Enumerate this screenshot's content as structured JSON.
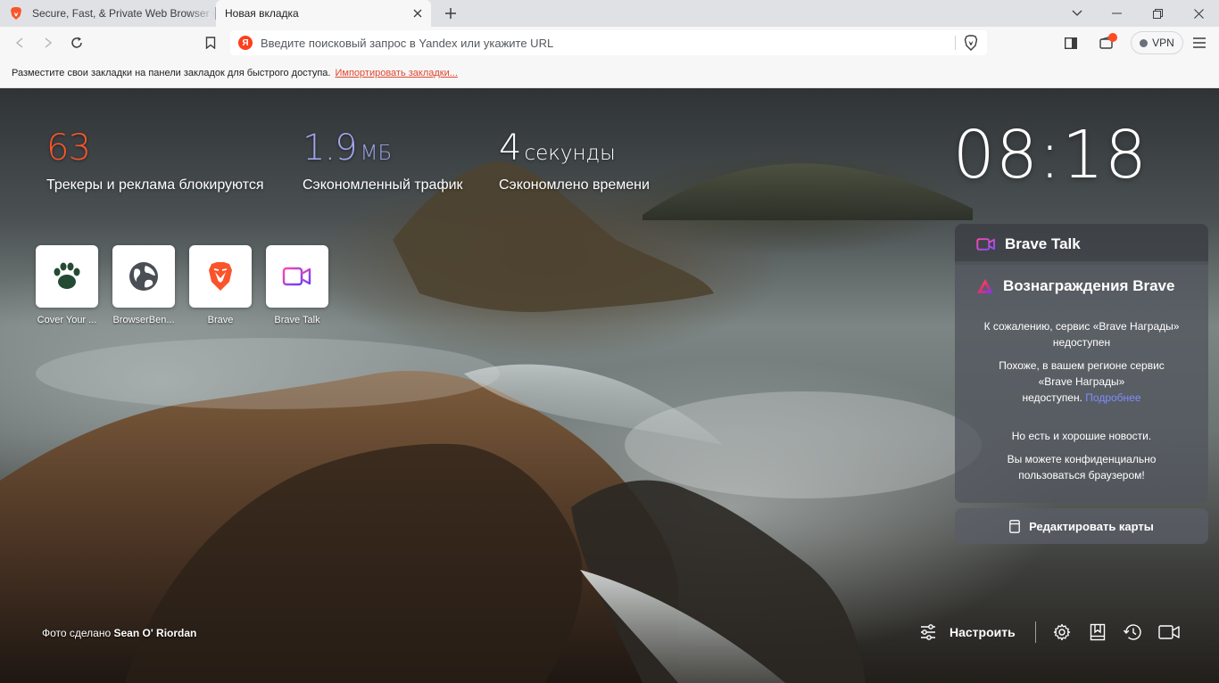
{
  "tabs": [
    {
      "title": "Secure, Fast, & Private Web Browser w",
      "icon": "brave-lion-icon",
      "active": false
    },
    {
      "title": "Новая вкладка",
      "active": true
    }
  ],
  "toolbar": {
    "search_engine_icon": "Я",
    "url_placeholder": "Введите поисковый запрос в Yandex или укажите URL",
    "vpn_label": "VPN"
  },
  "bookmarks_bar": {
    "message": "Разместите свои закладки на панели закладок для быстрого доступа.",
    "import_link": "Импортировать закладки..."
  },
  "stats": {
    "trackers": {
      "value": "63",
      "label": "Трекеры и реклама блокируются",
      "color": "#fb542b"
    },
    "bandwidth": {
      "value": "1.9",
      "unit": "МБ",
      "label": "Сэкономленный трафик",
      "color": "#a0a5eb"
    },
    "time": {
      "value": "4",
      "unit": "секунды",
      "label": "Сэкономлено времени",
      "color": "#ffffff"
    }
  },
  "clock": "08:18",
  "top_sites": [
    {
      "label": "Cover Your ...",
      "icon": "bear-paw-icon"
    },
    {
      "label": "BrowserBen...",
      "icon": "globe-icon"
    },
    {
      "label": "Brave",
      "icon": "brave-lion-icon"
    },
    {
      "label": "Brave Talk",
      "icon": "video-camera-icon"
    }
  ],
  "brave_talk": {
    "title": "Brave Talk"
  },
  "rewards": {
    "title": "Вознаграждения Brave",
    "line1": "К сожалению, сервис «Brave Награды»",
    "line2": "недоступен",
    "line3": "Похоже, в вашем регионе сервис",
    "line4": "«Brave Награды»",
    "line5": "недоступен.",
    "link": "Подробнее",
    "line6": "Но есть и хорошие новости.",
    "line7": "Вы можете конфиденциально",
    "line8": "пользоваться браузером!"
  },
  "edit_cards_label": "Редактировать карты",
  "photo_credit": {
    "prefix": "Фото сделано",
    "author": "Sean O' Riordan"
  },
  "customize_label": "Настроить",
  "colors": {
    "accent": "#fb542b",
    "link": "#7f8cff",
    "tabstrip": "#dfe1e5",
    "toolbar": "#f7f7f8"
  }
}
